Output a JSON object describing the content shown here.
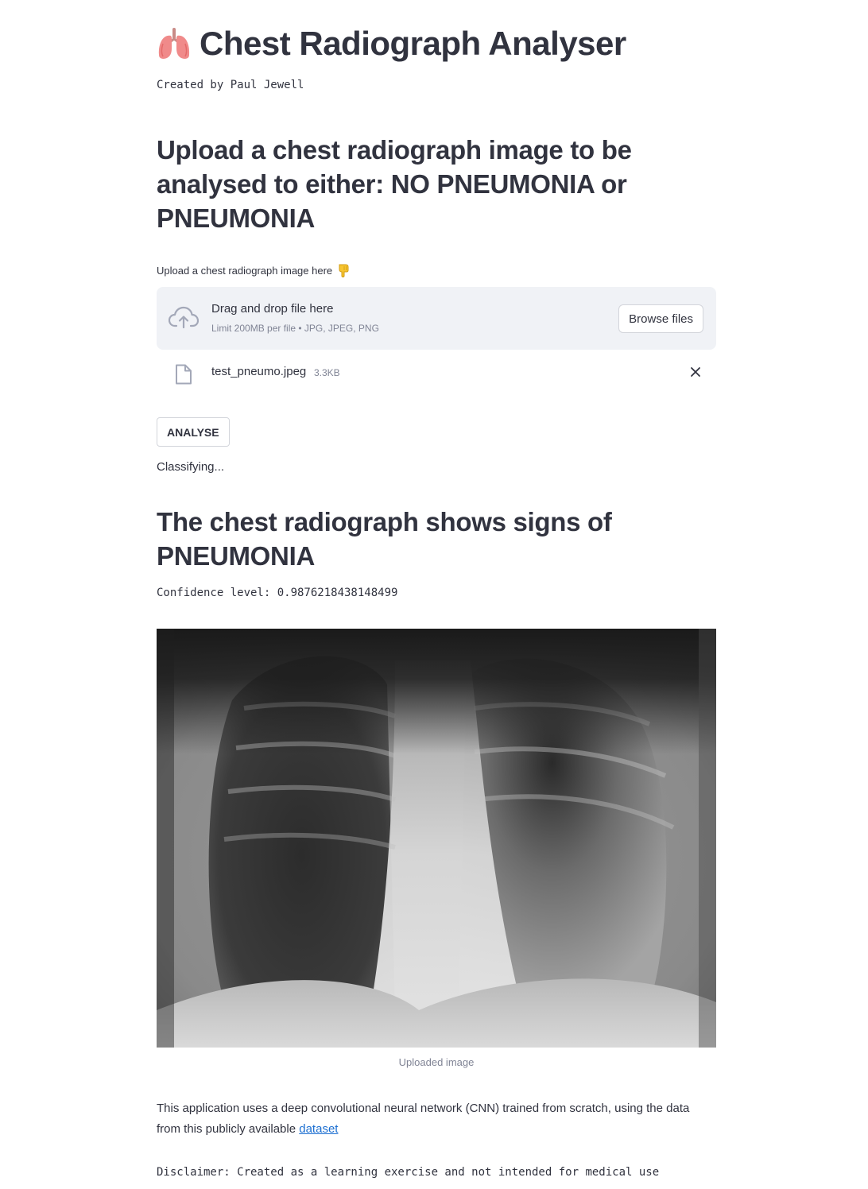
{
  "header": {
    "title": "Chest Radiograph Analyser",
    "title_icon": "lungs-icon",
    "author": "Created by Paul Jewell"
  },
  "upload": {
    "heading": "Upload a chest radiograph image to be analysed to either: NO PNEUMONIA or PNEUMONIA",
    "label": "Upload a chest radiograph image here",
    "label_icon": "pointing-down-hand-icon",
    "dropzone_title": "Drag and drop file here",
    "dropzone_limit": "Limit 200MB per file • JPG, JPEG, PNG",
    "browse_label": "Browse files",
    "file": {
      "name": "test_pneumo.jpeg",
      "size": "3.3KB"
    }
  },
  "actions": {
    "analyse_label": "ANALYSE",
    "status": "Classifying..."
  },
  "result": {
    "heading": "The chest radiograph shows signs of PNEUMONIA",
    "confidence": "Confidence level: 0.9876218438148499",
    "image_caption": "Uploaded image"
  },
  "footer": {
    "description": "This application uses a deep convolutional neural network (CNN) trained from scratch, using the data from this publicly available",
    "link_text": "dataset",
    "disclaimer": "Disclaimer: Created as a learning exercise and not intended for medical use"
  },
  "colors": {
    "text": "#31333f",
    "muted": "#808495",
    "dropzone_bg": "#f0f2f6",
    "link": "#1c6fd1"
  }
}
